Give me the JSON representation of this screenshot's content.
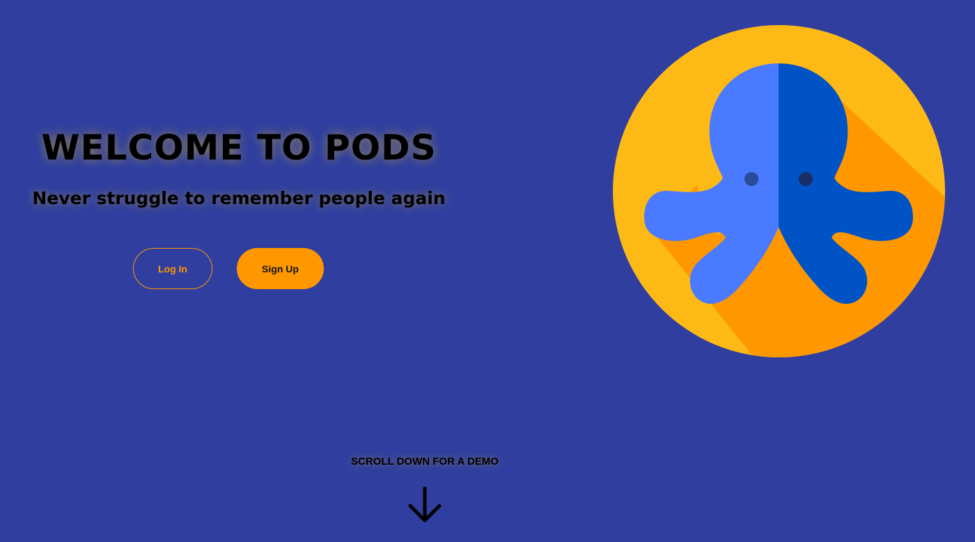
{
  "hero": {
    "title": "WELCOME TO PODS",
    "subtitle": "Never struggle to remember people again"
  },
  "actions": {
    "login_label": "Log In",
    "signup_label": "Sign Up"
  },
  "scroll": {
    "hint": "SCROLL DOWN FOR A DEMO",
    "icon": "arrow-down-icon"
  },
  "logo": {
    "icon": "octopus-logo"
  },
  "colors": {
    "background": "#303f9f",
    "accent": "#ff9800",
    "logo_circle": "#fdb915",
    "logo_shadow": "#ff9800",
    "octopus_light": "#4a7aff",
    "octopus_dark": "#0053c4"
  }
}
